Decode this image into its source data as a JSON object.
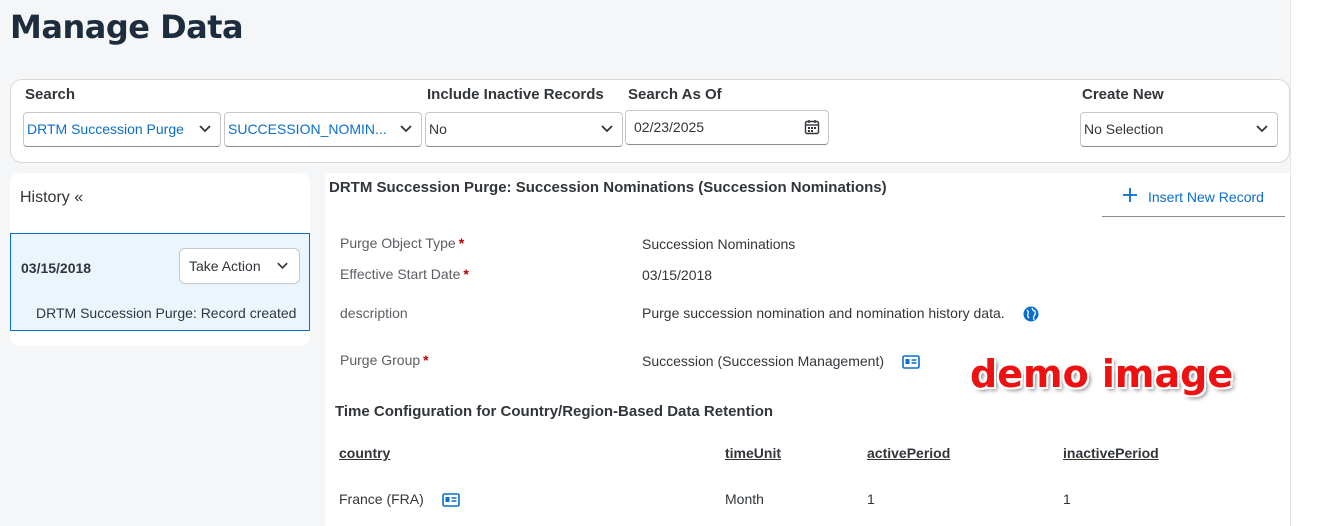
{
  "page": {
    "title": "Manage Data"
  },
  "search": {
    "label": "Search",
    "object_select": "DRTM Succession Purge",
    "instance_select": "SUCCESSION_NOMIN...",
    "inactive_label": "Include Inactive Records",
    "inactive_value": "No",
    "asof_label": "Search As Of",
    "asof_value": "02/23/2025",
    "create_label": "Create New",
    "create_value": "No Selection"
  },
  "history": {
    "title": "History «",
    "items": [
      {
        "date": "03/15/2018",
        "action_label": "Take Action",
        "description": "DRTM Succession Purge: Record created"
      }
    ]
  },
  "main": {
    "title": "DRTM Succession Purge: Succession Nominations (Succession Nominations)",
    "insert_label": "Insert New Record",
    "fields": [
      {
        "label": "Purge Object Type",
        "required": "*",
        "value": "Succession Nominations"
      },
      {
        "label": "Effective Start Date",
        "required": "*",
        "value": "03/15/2018"
      },
      {
        "label": "description",
        "required": "",
        "value": "Purge succession nomination and nomination history data."
      },
      {
        "label": "Purge Group",
        "required": "*",
        "value": "Succession (Succession Management)"
      }
    ],
    "section_title": "Time Configuration for Country/Region-Based Data Retention",
    "table": {
      "headers": [
        "country",
        "timeUnit",
        "activePeriod",
        "inactivePeriod"
      ],
      "rows": [
        [
          "France (FRA)",
          "Month",
          "1",
          "1"
        ]
      ]
    }
  },
  "watermark": "demo image",
  "colors": {
    "accent": "#0a6ed1",
    "required": "#bb0000",
    "selected_bg": "#ebf5fe",
    "watermark": "#ee1111"
  },
  "icons": [
    "chevron-down-icon",
    "calendar-icon",
    "plus-icon",
    "globe-icon",
    "id-card-icon"
  ]
}
